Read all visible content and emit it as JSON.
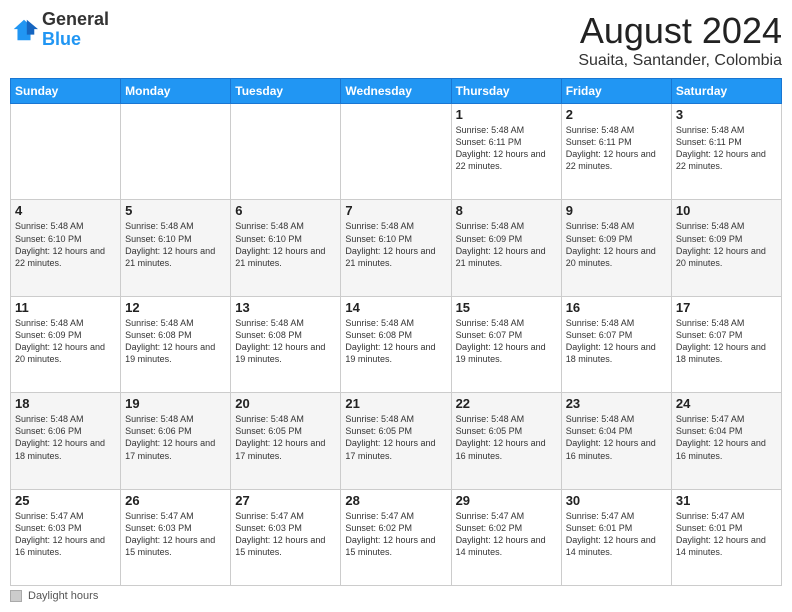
{
  "logo": {
    "general": "General",
    "blue": "Blue"
  },
  "header": {
    "month_year": "August 2024",
    "location": "Suaita, Santander, Colombia"
  },
  "days_of_week": [
    "Sunday",
    "Monday",
    "Tuesday",
    "Wednesday",
    "Thursday",
    "Friday",
    "Saturday"
  ],
  "footer": {
    "daylight_label": "Daylight hours"
  },
  "weeks": [
    [
      {
        "day": "",
        "info": ""
      },
      {
        "day": "",
        "info": ""
      },
      {
        "day": "",
        "info": ""
      },
      {
        "day": "",
        "info": ""
      },
      {
        "day": "1",
        "info": "Sunrise: 5:48 AM\nSunset: 6:11 PM\nDaylight: 12 hours\nand 22 minutes."
      },
      {
        "day": "2",
        "info": "Sunrise: 5:48 AM\nSunset: 6:11 PM\nDaylight: 12 hours\nand 22 minutes."
      },
      {
        "day": "3",
        "info": "Sunrise: 5:48 AM\nSunset: 6:11 PM\nDaylight: 12 hours\nand 22 minutes."
      }
    ],
    [
      {
        "day": "4",
        "info": "Sunrise: 5:48 AM\nSunset: 6:10 PM\nDaylight: 12 hours\nand 22 minutes."
      },
      {
        "day": "5",
        "info": "Sunrise: 5:48 AM\nSunset: 6:10 PM\nDaylight: 12 hours\nand 21 minutes."
      },
      {
        "day": "6",
        "info": "Sunrise: 5:48 AM\nSunset: 6:10 PM\nDaylight: 12 hours\nand 21 minutes."
      },
      {
        "day": "7",
        "info": "Sunrise: 5:48 AM\nSunset: 6:10 PM\nDaylight: 12 hours\nand 21 minutes."
      },
      {
        "day": "8",
        "info": "Sunrise: 5:48 AM\nSunset: 6:09 PM\nDaylight: 12 hours\nand 21 minutes."
      },
      {
        "day": "9",
        "info": "Sunrise: 5:48 AM\nSunset: 6:09 PM\nDaylight: 12 hours\nand 20 minutes."
      },
      {
        "day": "10",
        "info": "Sunrise: 5:48 AM\nSunset: 6:09 PM\nDaylight: 12 hours\nand 20 minutes."
      }
    ],
    [
      {
        "day": "11",
        "info": "Sunrise: 5:48 AM\nSunset: 6:09 PM\nDaylight: 12 hours\nand 20 minutes."
      },
      {
        "day": "12",
        "info": "Sunrise: 5:48 AM\nSunset: 6:08 PM\nDaylight: 12 hours\nand 19 minutes."
      },
      {
        "day": "13",
        "info": "Sunrise: 5:48 AM\nSunset: 6:08 PM\nDaylight: 12 hours\nand 19 minutes."
      },
      {
        "day": "14",
        "info": "Sunrise: 5:48 AM\nSunset: 6:08 PM\nDaylight: 12 hours\nand 19 minutes."
      },
      {
        "day": "15",
        "info": "Sunrise: 5:48 AM\nSunset: 6:07 PM\nDaylight: 12 hours\nand 19 minutes."
      },
      {
        "day": "16",
        "info": "Sunrise: 5:48 AM\nSunset: 6:07 PM\nDaylight: 12 hours\nand 18 minutes."
      },
      {
        "day": "17",
        "info": "Sunrise: 5:48 AM\nSunset: 6:07 PM\nDaylight: 12 hours\nand 18 minutes."
      }
    ],
    [
      {
        "day": "18",
        "info": "Sunrise: 5:48 AM\nSunset: 6:06 PM\nDaylight: 12 hours\nand 18 minutes."
      },
      {
        "day": "19",
        "info": "Sunrise: 5:48 AM\nSunset: 6:06 PM\nDaylight: 12 hours\nand 17 minutes."
      },
      {
        "day": "20",
        "info": "Sunrise: 5:48 AM\nSunset: 6:05 PM\nDaylight: 12 hours\nand 17 minutes."
      },
      {
        "day": "21",
        "info": "Sunrise: 5:48 AM\nSunset: 6:05 PM\nDaylight: 12 hours\nand 17 minutes."
      },
      {
        "day": "22",
        "info": "Sunrise: 5:48 AM\nSunset: 6:05 PM\nDaylight: 12 hours\nand 16 minutes."
      },
      {
        "day": "23",
        "info": "Sunrise: 5:48 AM\nSunset: 6:04 PM\nDaylight: 12 hours\nand 16 minutes."
      },
      {
        "day": "24",
        "info": "Sunrise: 5:47 AM\nSunset: 6:04 PM\nDaylight: 12 hours\nand 16 minutes."
      }
    ],
    [
      {
        "day": "25",
        "info": "Sunrise: 5:47 AM\nSunset: 6:03 PM\nDaylight: 12 hours\nand 16 minutes."
      },
      {
        "day": "26",
        "info": "Sunrise: 5:47 AM\nSunset: 6:03 PM\nDaylight: 12 hours\nand 15 minutes."
      },
      {
        "day": "27",
        "info": "Sunrise: 5:47 AM\nSunset: 6:03 PM\nDaylight: 12 hours\nand 15 minutes."
      },
      {
        "day": "28",
        "info": "Sunrise: 5:47 AM\nSunset: 6:02 PM\nDaylight: 12 hours\nand 15 minutes."
      },
      {
        "day": "29",
        "info": "Sunrise: 5:47 AM\nSunset: 6:02 PM\nDaylight: 12 hours\nand 14 minutes."
      },
      {
        "day": "30",
        "info": "Sunrise: 5:47 AM\nSunset: 6:01 PM\nDaylight: 12 hours\nand 14 minutes."
      },
      {
        "day": "31",
        "info": "Sunrise: 5:47 AM\nSunset: 6:01 PM\nDaylight: 12 hours\nand 14 minutes."
      }
    ]
  ]
}
